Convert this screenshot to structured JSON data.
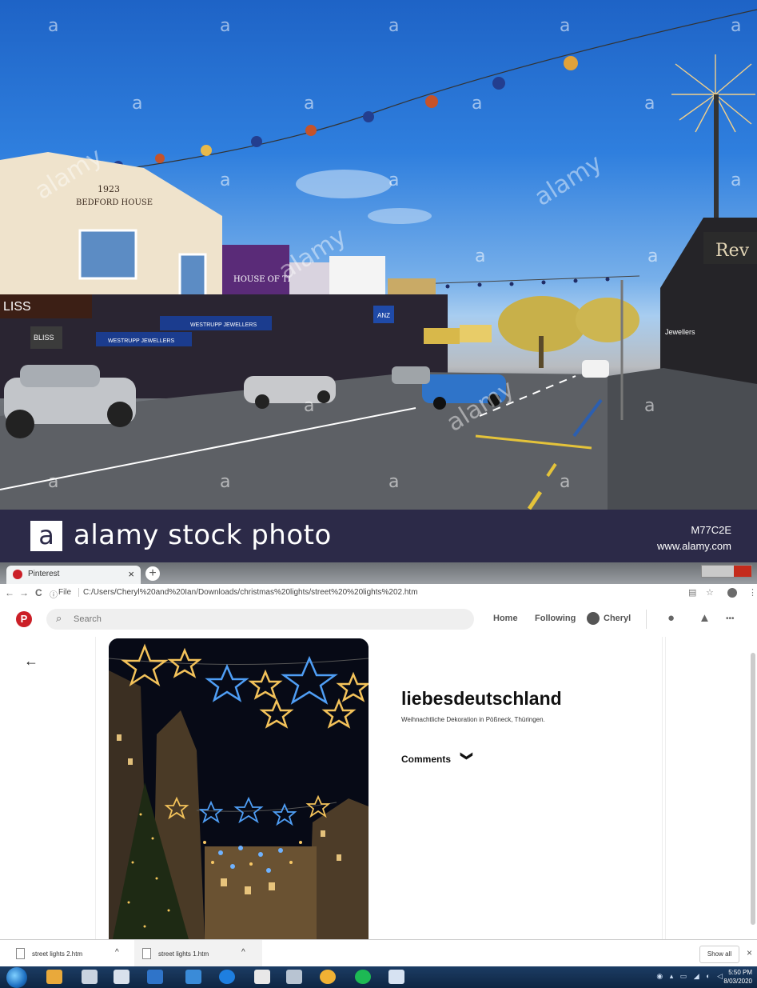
{
  "photo": {
    "watermark_letter": "a",
    "watermark_word": "alamy",
    "building_date": "1923",
    "building_name": "BEDFORD HOUSE",
    "shop_signs": [
      "LISS",
      "HOUSE OF TRAVEL",
      "WESTRUPP JEWELLERS",
      "WESTRUPP JEWELLERS",
      "BLISS",
      "ANZ",
      "Rev",
      "Jewellers"
    ],
    "banner": {
      "logo_letter": "a",
      "brand": "alamy stock photo",
      "image_code": "M77C2E",
      "site": "www.alamy.com"
    }
  },
  "browser": {
    "tab_title": "Pinterest",
    "tab_close": "×",
    "new_tab": "+",
    "nav_back": "←",
    "nav_forward": "→",
    "nav_reload": "C",
    "file_label": "File",
    "url": "C:/Users/Cheryl%20and%20Ian/Downloads/christmas%20lights/street%20%20lights%202.htm"
  },
  "pinterest": {
    "search_placeholder": "Search",
    "nav": {
      "home": "Home",
      "following": "Following",
      "user": "Cheryl"
    },
    "more": "•••",
    "pin": {
      "back": "←",
      "username": "liebesdeutschland",
      "description": "Weihnachtliche Dekoration in Pößneck, Thüringen.",
      "comments_label": "Comments",
      "comments_chevron": "❯"
    }
  },
  "downloads": {
    "items": [
      {
        "name": "street lights 2.htm",
        "caret": "^"
      },
      {
        "name": "street lights 1.htm",
        "caret": "^"
      }
    ],
    "show_all": "Show all",
    "close": "×"
  },
  "taskbar": {
    "time": "5:50 PM",
    "date": "8/03/2020"
  }
}
